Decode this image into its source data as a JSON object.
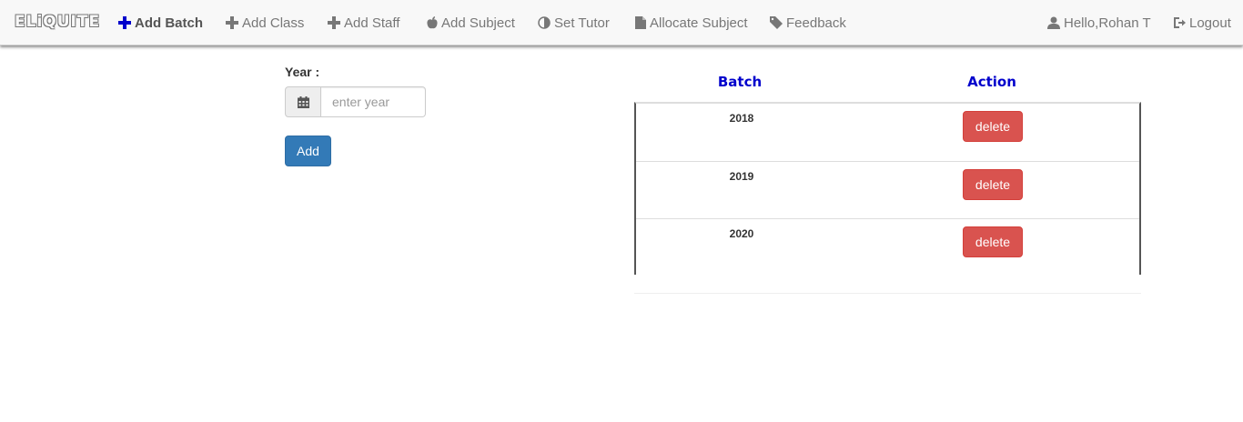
{
  "navbar": {
    "brand": "ELiQUITE",
    "items": [
      {
        "label": "Add Batch",
        "icon": "plus-icon",
        "active": true
      },
      {
        "label": "Add Class",
        "icon": "plus-icon"
      },
      {
        "label": "Add Staff",
        "icon": "plus-icon"
      },
      {
        "label": "Add Subject",
        "icon": "apple-icon"
      },
      {
        "label": "Set Tutor",
        "icon": "half-circle-icon"
      },
      {
        "label": "Allocate Subject",
        "icon": "file-icon"
      },
      {
        "label": "Feedback",
        "icon": "tag-icon"
      }
    ],
    "user_greeting": "Hello,Rohan T",
    "logout_label": "Logout"
  },
  "form": {
    "year_label": "Year :",
    "year_placeholder": "enter year",
    "year_value": "",
    "add_label": "Add"
  },
  "table": {
    "headers": {
      "batch": "Batch",
      "action": "Action"
    },
    "rows": [
      {
        "year": "2018",
        "action_label": "delete"
      },
      {
        "year": "2019",
        "action_label": "delete"
      },
      {
        "year": "2020",
        "action_label": "delete"
      }
    ]
  },
  "colors": {
    "primary": "#337ab7",
    "danger": "#d9534f",
    "header_text": "#0000cc",
    "active_icon": "#0000cc"
  }
}
